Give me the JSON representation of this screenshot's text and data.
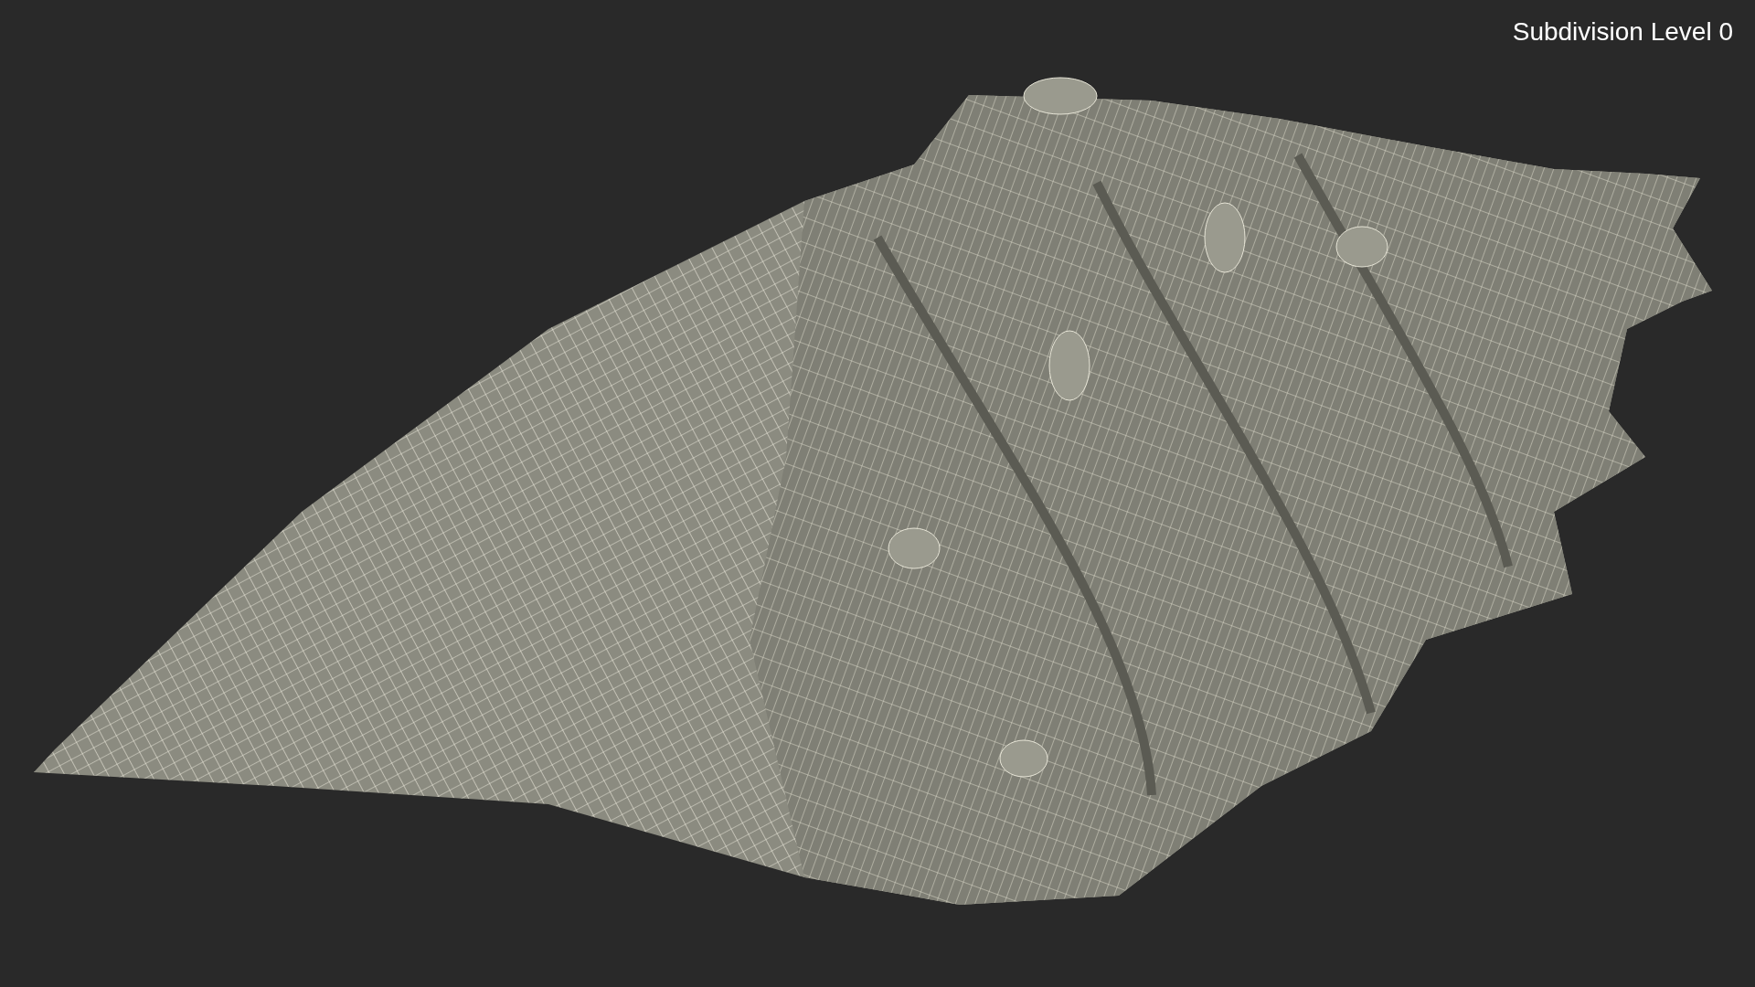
{
  "viewport_label": "Subdivision Level 0"
}
